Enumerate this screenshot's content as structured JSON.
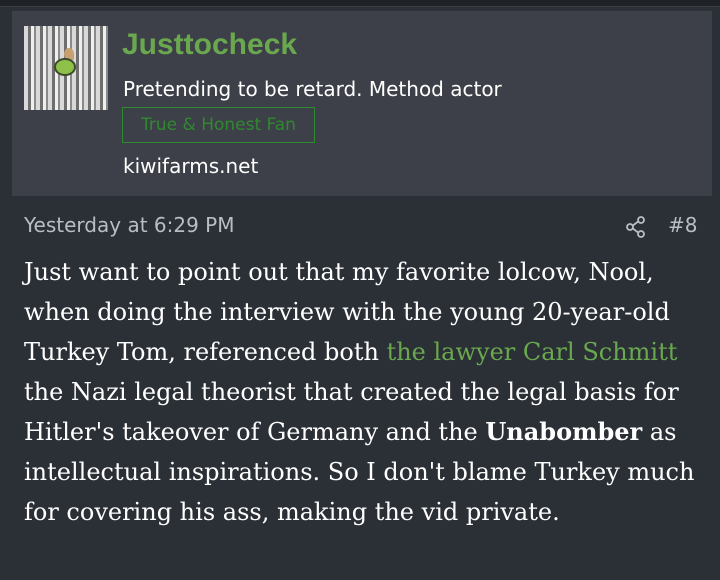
{
  "user": {
    "name": "Justtocheck",
    "title": "Pretending to be retard. Method actor",
    "banner": "True & Honest Fan",
    "site": "kiwifarms.net"
  },
  "post": {
    "timestamp": "Yesterday at 6:29 PM",
    "number": "#8",
    "body": {
      "p1": "Just want to point out that my favorite lolcow, Nool, when doing the interview with the young 20-year-old Turkey Tom, referenced both ",
      "link": "the lawyer Carl Schmitt",
      "p2": " the Nazi legal theorist that created the legal basis for Hitler's takeover of Germany and the ",
      "bold": "Unabomber",
      "p3": " as intellectual inspirations. So I don't blame Turkey much for covering his ass, making the vid private."
    }
  },
  "colors": {
    "background": "#2b2f36",
    "user_block": "#3d4048",
    "username": "#6aa84f",
    "link": "#6aa84f",
    "banner": "#2f8a2f",
    "meta_text": "#b9bdc4"
  },
  "icons": {
    "share": "share-icon"
  }
}
